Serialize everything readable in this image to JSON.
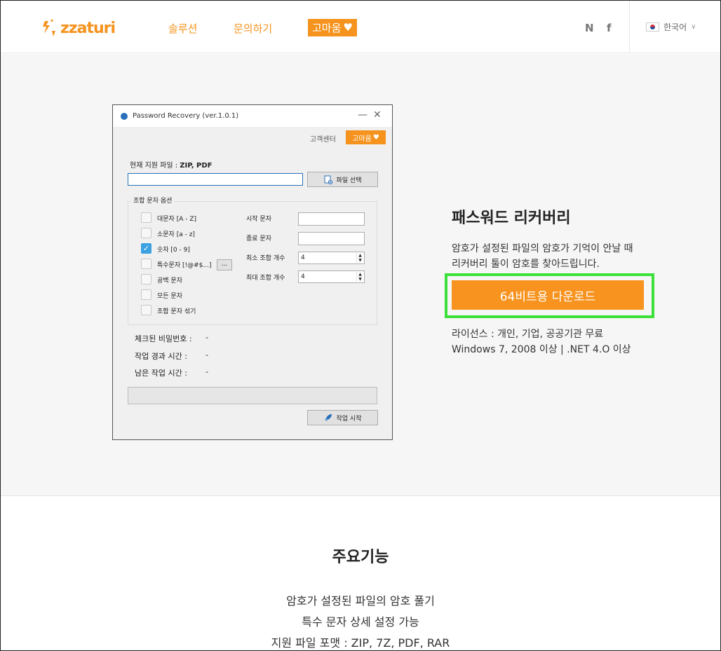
{
  "header": {
    "logo_text": "zzaturi",
    "nav": {
      "solution": "솔루션",
      "inquiry": "문의하기",
      "thanks": "고마움"
    },
    "social": {
      "naver": "N",
      "facebook": "f"
    },
    "language": "한국어",
    "brand_color": "#f5931e"
  },
  "app_window": {
    "title": "Password Recovery (ver.1.0.1)",
    "customer_center": "고객센터",
    "thanks_button": "고마움",
    "supported_label": "현재 지원 파일 :",
    "supported_value": "ZIP, PDF",
    "path_value": "",
    "file_select": "파일 선택",
    "group_title": "조합 문자 옵션",
    "checkboxes": [
      {
        "label": "대문자 [A - Z]",
        "checked": false
      },
      {
        "label": "소문자 [a - z]",
        "checked": false
      },
      {
        "label": "숫자 [0 - 9]",
        "checked": true
      },
      {
        "label": "특수문자 [!@#$...]",
        "checked": false
      },
      {
        "label": "공백 문자",
        "checked": false
      },
      {
        "label": "모든 문자",
        "checked": false
      },
      {
        "label": "조합 문자 섞기",
        "checked": false
      }
    ],
    "special_more": "...",
    "fields": {
      "start_char": "시작 문자",
      "end_char": "종료 문자",
      "min_count": "최소 조합 개수",
      "min_count_value": "4",
      "max_count": "최대 조합 개수",
      "max_count_value": "4"
    },
    "stats": [
      {
        "label": "체크된 비밀번호 :",
        "value": "-"
      },
      {
        "label": "작업 경과 시간 :",
        "value": "-"
      },
      {
        "label": "남은 작업 시간 :",
        "value": "-"
      }
    ],
    "progress": 0,
    "start_button": "작업 시작"
  },
  "product": {
    "title": "패스워드 리커버리",
    "desc_line1": "암호가 설정된 파일의 암호가 기억이 안날 때",
    "desc_line2": "리커버리 툴이 암호를 찾아드립니다.",
    "download": "64비트용 다운로드",
    "license_line1": "라이선스 : 개인, 기업, 공공기관 무료",
    "license_line2": "Windows 7, 2008 이상 | .NET 4.O 이상",
    "highlight_color": "#3de03a"
  },
  "features": {
    "title": "주요기능",
    "items": [
      "암호가 설정된 파일의 암호 풀기",
      "특수 문자 상세 설정 가능",
      "지원 파일 포맷 : ZIP, 7Z, PDF, RAR"
    ]
  }
}
